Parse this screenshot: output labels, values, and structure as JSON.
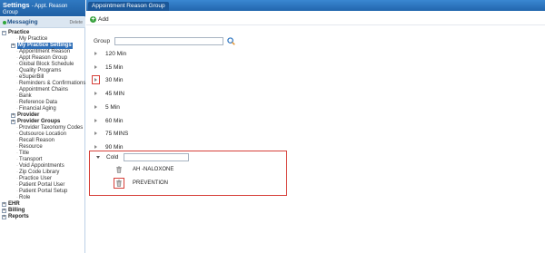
{
  "left": {
    "title": "Settings",
    "title_sub": "- Appt. Reason",
    "title_line2": "Group",
    "messaging": {
      "label": "Messaging",
      "delete": "Delete"
    },
    "tree": [
      {
        "label": "Practice",
        "level": 0,
        "expander": "−"
      },
      {
        "label": "My Practice",
        "level": 1
      },
      {
        "label": "My Practice Settings",
        "level": "1b",
        "expander": "+",
        "selected": true
      },
      {
        "label": "Appointment Reason",
        "level": 1
      },
      {
        "label": "Appt Reason Group",
        "level": 1
      },
      {
        "label": "Global Block Schedule",
        "level": 1
      },
      {
        "label": "Quality Programs",
        "level": 1
      },
      {
        "label": "eSuperBill",
        "level": 1
      },
      {
        "label": "Reminders & Confirmations",
        "level": 1
      },
      {
        "label": "Appointment Chains",
        "level": 1
      },
      {
        "label": "Bank",
        "level": 1
      },
      {
        "label": "Reference Data",
        "level": 1
      },
      {
        "label": "Financial Aging",
        "level": 1
      },
      {
        "label": "Provider",
        "level": "1b",
        "expander": "+"
      },
      {
        "label": "Provider Groups",
        "level": "1b",
        "expander": "+"
      },
      {
        "label": "Provider Taxonomy Codes",
        "level": 1
      },
      {
        "label": "Outsource Location",
        "level": 1
      },
      {
        "label": "Recall Reason",
        "level": 1
      },
      {
        "label": "Resource",
        "level": 1
      },
      {
        "label": "Title",
        "level": 1
      },
      {
        "label": "Transport",
        "level": 1
      },
      {
        "label": "Void Appointments",
        "level": 1
      },
      {
        "label": "Zip Code Library",
        "level": 1
      },
      {
        "label": "Practice User",
        "level": 1
      },
      {
        "label": "Patient Portal User",
        "level": 1
      },
      {
        "label": "Patient Portal Setup",
        "level": 1
      },
      {
        "label": "Role",
        "level": 1
      },
      {
        "label": "EHR",
        "level": 0,
        "expander": "+"
      },
      {
        "label": "Billing",
        "level": 0,
        "expander": "+"
      },
      {
        "label": "Reports",
        "level": 0,
        "expander": "+"
      }
    ]
  },
  "main": {
    "tab": "Appointment Reason Group",
    "add_label": "Add",
    "group_label": "Group",
    "group_value": "",
    "groups": [
      "120 Min",
      "15 Min",
      "30 Min",
      "45 MIN",
      "5 Min",
      "60 Min",
      "75 MINS",
      "90 Min"
    ],
    "highlighted_group_index": 2,
    "expanded_group": {
      "name": "Cold",
      "input_value": "",
      "items": [
        "AH -NALOXONE",
        "PREVENTION"
      ],
      "highlighted_item_index": 1
    }
  },
  "colors": {
    "header_blue": "#1f5fa3",
    "selected_blue": "#2f6fb8",
    "highlight_red": "#d6403a",
    "add_green": "#3aa33f"
  },
  "icons": {
    "add": "plus-circle-icon",
    "search": "magnifier-icon",
    "delete": "trash-icon",
    "collapsed": "triangle-right-icon",
    "expanded": "triangle-down-icon"
  }
}
